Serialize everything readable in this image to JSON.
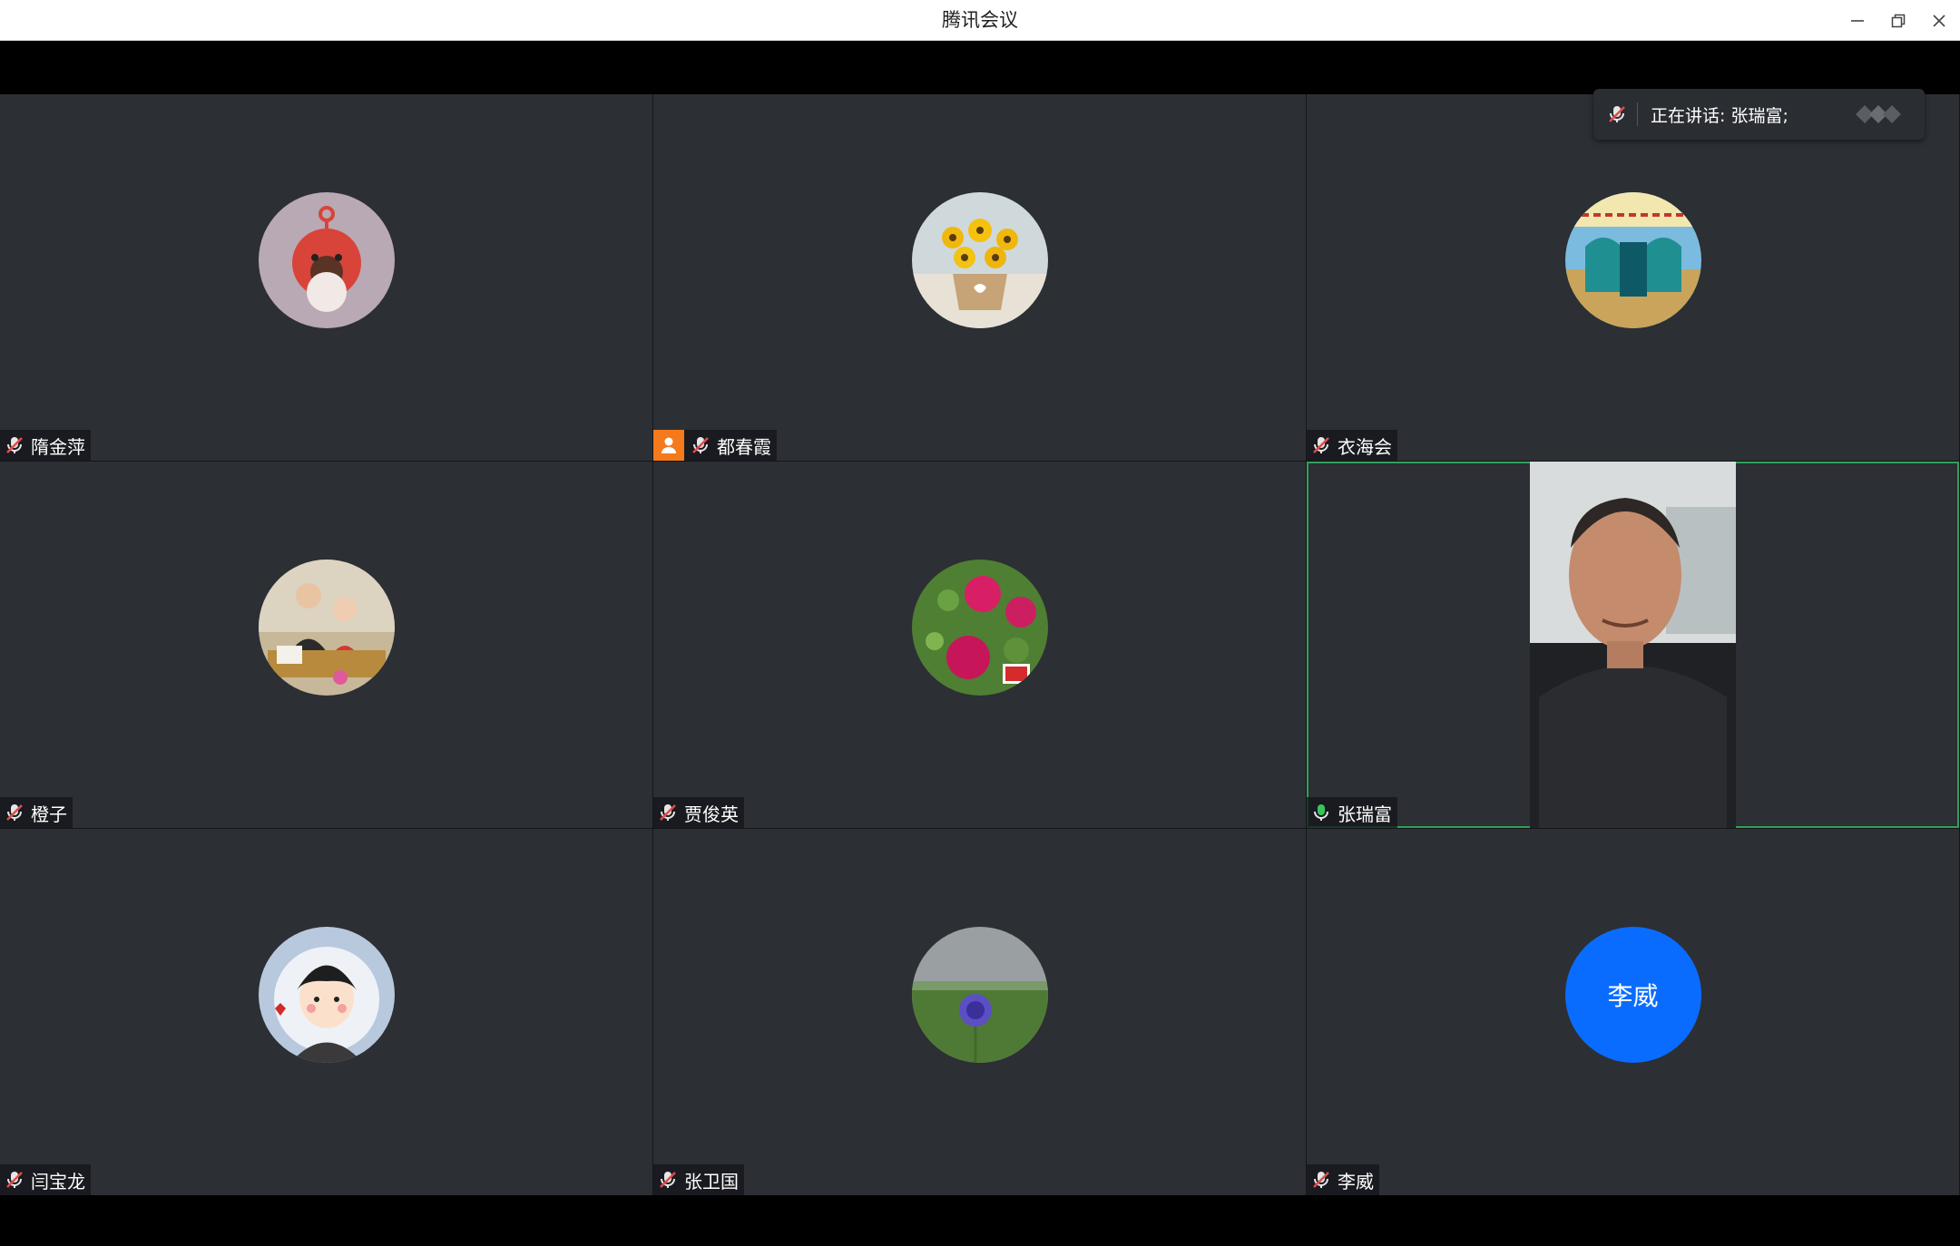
{
  "window": {
    "title": "腾讯会议"
  },
  "speaking_banner": {
    "text": "正在讲话: 张瑞富;"
  },
  "colors": {
    "accent": "#0a6cff",
    "active_border": "#2fa05a",
    "host_badge": "#f57a1c",
    "muted_mic": "#e24b4b",
    "tile_bg": "#2c2f34"
  },
  "participants": [
    {
      "name": "隋金萍",
      "mic": "muted",
      "avatar": "cartoon-red-character"
    },
    {
      "name": "都春霞",
      "mic": "muted",
      "avatar": "sunflower-basket",
      "host": true
    },
    {
      "name": "衣海会",
      "mic": "muted",
      "avatar": "vase-poster"
    },
    {
      "name": "橙子",
      "mic": "muted",
      "avatar": "family-photo"
    },
    {
      "name": "贾俊英",
      "mic": "muted",
      "avatar": "peony-flowers"
    },
    {
      "name": "张瑞富",
      "mic": "active",
      "video": true,
      "speaking": true
    },
    {
      "name": "闫宝龙",
      "mic": "muted",
      "avatar": "cartoon-boy"
    },
    {
      "name": "张卫国",
      "mic": "muted",
      "avatar": "purple-thistle"
    },
    {
      "name": "李威",
      "mic": "muted",
      "avatar_initials": "李威"
    }
  ]
}
